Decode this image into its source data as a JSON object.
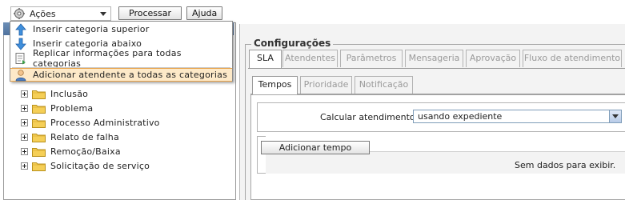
{
  "toolbar": {
    "actions_label": "Ações",
    "process_label": "Processar",
    "help_label": "Ajuda"
  },
  "menu": {
    "items": [
      {
        "label": "Inserir categoria superior",
        "icon": "arrow-up-icon"
      },
      {
        "label": "Inserir categoria abaixo",
        "icon": "arrow-down-icon"
      },
      {
        "label": "Replicar informações para todas categorias",
        "icon": "replicate-icon"
      },
      {
        "label": "Adicionar atendente a todas as categorias",
        "icon": "user-icon"
      }
    ]
  },
  "tree": {
    "items": [
      {
        "label": "Inclusão"
      },
      {
        "label": "Problema"
      },
      {
        "label": "Processo Administrativo"
      },
      {
        "label": "Relato de falha"
      },
      {
        "label": "Remoção/Baixa"
      },
      {
        "label": "Solicitação de serviço"
      }
    ]
  },
  "config": {
    "legend": "Configurações",
    "tabs": [
      "SLA",
      "Atendentes",
      "Parâmetros",
      "Mensageria",
      "Aprovação",
      "Fluxo de atendimento"
    ],
    "active_tab": "SLA",
    "subtabs": [
      "Tempos",
      "Prioridade",
      "Notificação"
    ],
    "active_subtab": "Tempos",
    "calc_label": "Calcular atendimento :",
    "calc_value": "usando expediente",
    "add_time_label": "Adicionar tempo",
    "no_data": "Sem dados para exibir."
  },
  "colors": {
    "accent_blue": "#5a7ca8",
    "menu_highlight": "#fde9c8",
    "folder_yellow": "#f2c94c"
  }
}
